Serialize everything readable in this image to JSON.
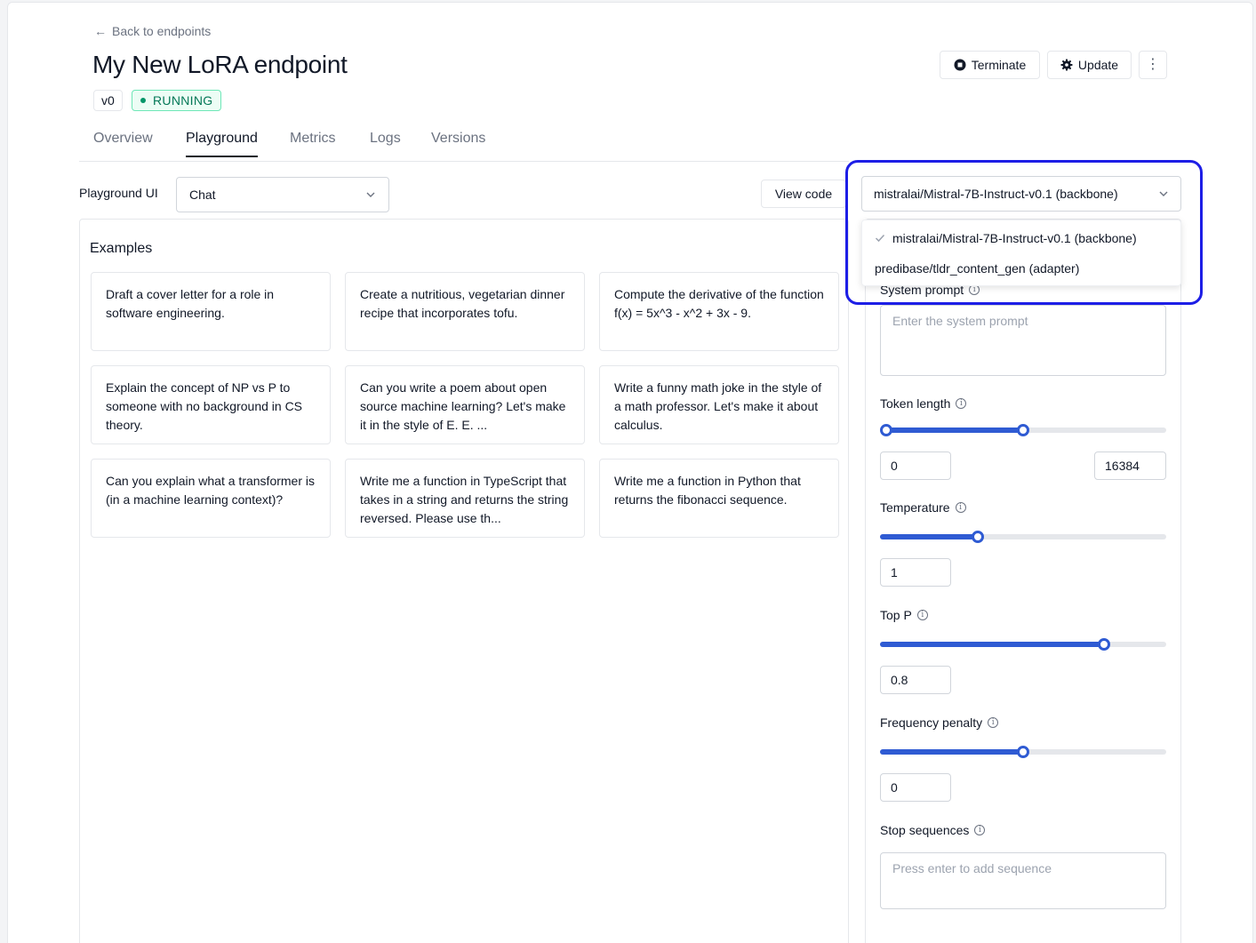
{
  "header": {
    "back_link": "Back to endpoints",
    "title": "My New LoRA endpoint",
    "version_badge": "v0",
    "status_badge": "RUNNING",
    "terminate_label": "Terminate",
    "update_label": "Update"
  },
  "tabs": [
    {
      "label": "Overview",
      "active": false
    },
    {
      "label": "Playground",
      "active": true
    },
    {
      "label": "Metrics",
      "active": false
    },
    {
      "label": "Logs",
      "active": false
    },
    {
      "label": "Versions",
      "active": false
    }
  ],
  "toolbar": {
    "playground_ui_label": "Playground UI",
    "playground_ui_value": "Chat",
    "view_code_label": "View code"
  },
  "model_select": {
    "value": "mistralai/Mistral-7B-Instruct-v0.1 (backbone)",
    "options": [
      {
        "label": "mistralai/Mistral-7B-Instruct-v0.1 (backbone)",
        "selected": true
      },
      {
        "label": "predibase/tldr_content_gen (adapter)",
        "selected": false
      }
    ]
  },
  "examples": {
    "heading": "Examples",
    "cards": [
      "Draft a cover letter for a role in software engineering.",
      "Create a nutritious, vegetarian dinner recipe that incorporates tofu.",
      "Compute the derivative of the function f(x) = 5x^3 - x^2 + 3x - 9.",
      "Explain the concept of NP vs P to someone with no background in CS theory.",
      "Can you write a poem about open source machine learning? Let's make it in the style of E. E. ...",
      "Write a funny math joke in the style of a math professor. Let's make it about calculus.",
      "Can you explain what a transformer is (in a machine learning context)?",
      "Write me a function in TypeScript that takes in a string and returns the string reversed. Please use th...",
      "Write me a function in Python that returns the fibonacci sequence."
    ]
  },
  "settings": {
    "system_prompt": {
      "label": "System prompt",
      "placeholder": "Enter the system prompt"
    },
    "token_length": {
      "label": "Token length",
      "min_value": "0",
      "max_value": "16384",
      "range_fraction": [
        0.0,
        0.5
      ]
    },
    "temperature": {
      "label": "Temperature",
      "value": "1",
      "fraction": 0.34
    },
    "top_p": {
      "label": "Top P",
      "value": "0.8",
      "fraction": 0.78
    },
    "frequency_penalty": {
      "label": "Frequency penalty",
      "value": "0",
      "fraction": 0.5
    },
    "stop_sequences": {
      "label": "Stop sequences",
      "placeholder": "Press enter to add sequence"
    }
  },
  "colors": {
    "accent": "#2f5bd3",
    "highlight": "#1d1ee6",
    "running_green": "#047857"
  }
}
